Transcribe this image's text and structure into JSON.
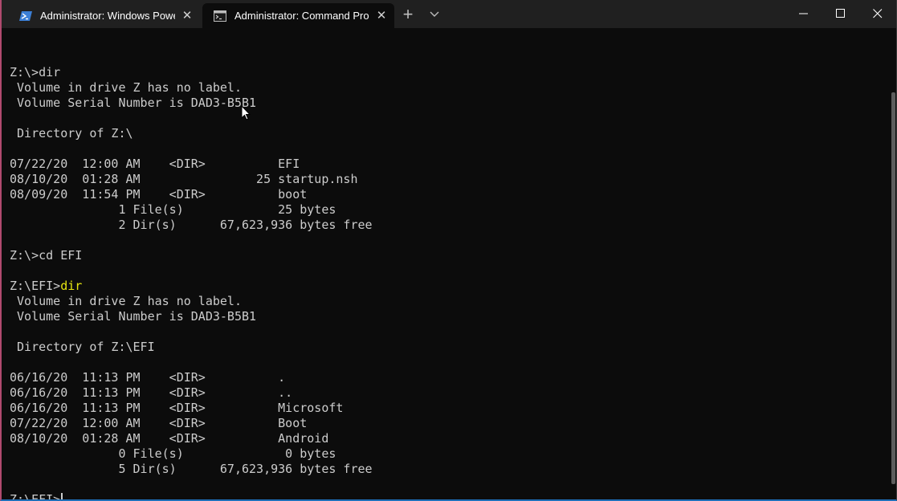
{
  "tabs": [
    {
      "title": "Administrator: Windows PowerShell",
      "active": false,
      "icon": "powershell-icon"
    },
    {
      "title": "Administrator: Command Prompt",
      "active": true,
      "icon": "cmd-icon"
    }
  ],
  "titlebar": {
    "new_tab_glyph": "+",
    "close_glyph": "✕"
  },
  "terminal": {
    "lines": [
      "",
      "Z:\\>dir",
      " Volume in drive Z has no label.",
      " Volume Serial Number is DAD3-B5B1",
      "",
      " Directory of Z:\\",
      "",
      "07/22/20  12:00 AM    <DIR>          EFI",
      "08/10/20  01:28 AM                25 startup.nsh",
      "08/09/20  11:54 PM    <DIR>          boot",
      "               1 File(s)             25 bytes",
      "               2 Dir(s)      67,623,936 bytes free",
      "",
      "Z:\\>cd EFI",
      "",
      "Z:\\EFI>",
      " Volume in drive Z has no label.",
      " Volume Serial Number is DAD3-B5B1",
      "",
      " Directory of Z:\\EFI",
      "",
      "06/16/20  11:13 PM    <DIR>          .",
      "06/16/20  11:13 PM    <DIR>          ..",
      "06/16/20  11:13 PM    <DIR>          Microsoft",
      "07/22/20  12:00 AM    <DIR>          Boot",
      "08/10/20  01:28 AM    <DIR>          Android",
      "               0 File(s)              0 bytes",
      "               5 Dir(s)      67,623,936 bytes free",
      "",
      "Z:\\EFI>"
    ],
    "highlighted_command": "dir",
    "highlight_color": "#e5e510",
    "text_color": "#cccccc",
    "background_color": "#0c0c0c"
  }
}
